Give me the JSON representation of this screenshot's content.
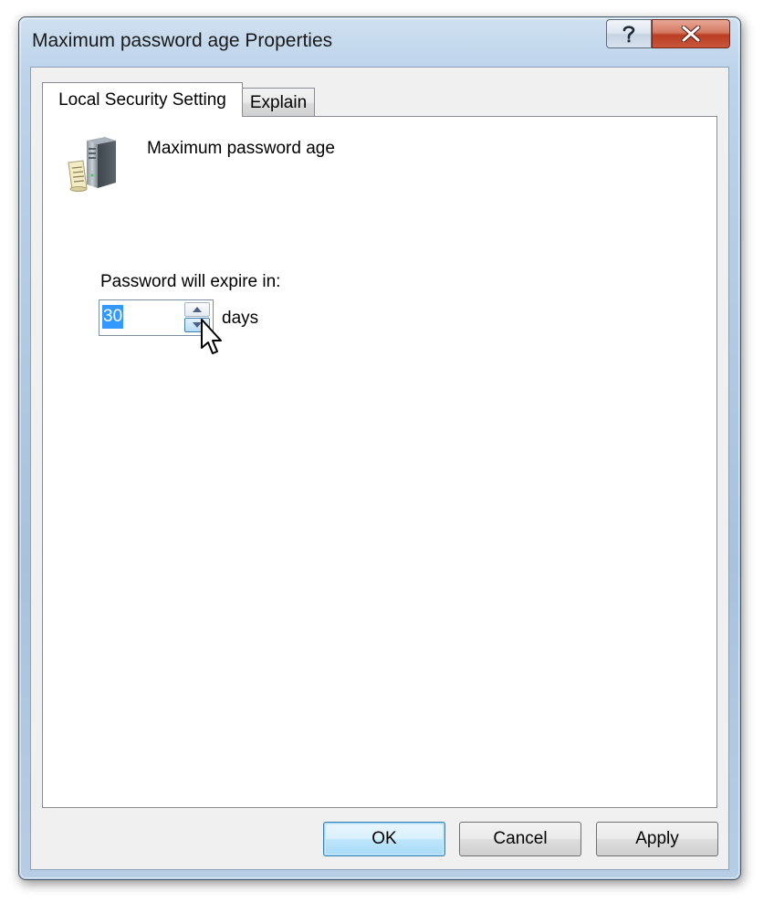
{
  "window": {
    "title": "Maximum password age Properties",
    "help_icon": "question-mark-icon",
    "close_icon": "close-x-icon"
  },
  "tabs": [
    {
      "label": "Local Security Setting",
      "active": true
    },
    {
      "label": "Explain",
      "active": false
    }
  ],
  "policy": {
    "icon": "server-policy-icon",
    "name": "Maximum password age"
  },
  "setting": {
    "label": "Password will expire in:",
    "value": "30",
    "unit": "days"
  },
  "buttons": {
    "ok": "OK",
    "cancel": "Cancel",
    "apply": "Apply"
  },
  "colors": {
    "selection": "#3399ff",
    "close_button": "#c9573a",
    "default_button_border": "#3c7fb1"
  }
}
